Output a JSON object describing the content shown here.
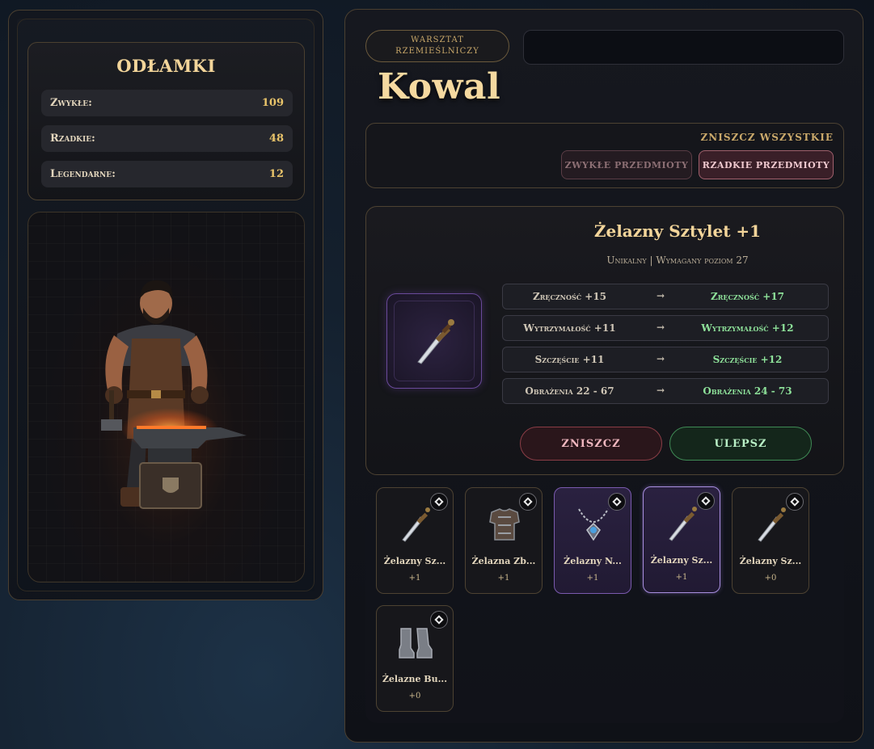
{
  "shards": {
    "title": "ODŁAMKI",
    "rows": [
      {
        "label": "Zwykłe:",
        "value": "109"
      },
      {
        "label": "Rzadkie:",
        "value": "48"
      },
      {
        "label": "Legendarne:",
        "value": "12"
      }
    ]
  },
  "header": {
    "badge_line1": "WARSZTAT",
    "badge_line2": "RZEMIEŚLNICZY",
    "title": "Kowal"
  },
  "destroy_all": {
    "label": "ZNISZCZ WSZYSTKIE",
    "common_button": "ZWYKŁE PRZEDMIOTY",
    "rare_button": "RZADKIE PRZEDMIOTY"
  },
  "selected_item": {
    "name": "Żelazny Sztylet +1",
    "meta": "Unikalny | Wymagany poziom 27",
    "icon": "dagger-icon",
    "stats": [
      {
        "old": "Zręczność +15",
        "arrow": "→",
        "new": "Zręczność +17"
      },
      {
        "old": "Wytrzymałość +11",
        "arrow": "→",
        "new": "Wytrzymałość +12"
      },
      {
        "old": "Szczęście +11",
        "arrow": "→",
        "new": "Szczęście +12"
      },
      {
        "old": "Obrażenia 22 - 67",
        "arrow": "→",
        "new": "Obrażenia 24 - 73"
      }
    ],
    "destroy_button": "ZNISZCZ",
    "upgrade_button": "ULEPSZ"
  },
  "inventory": [
    {
      "name": "Żelazny Sz...",
      "level": "+1",
      "icon": "dagger-icon",
      "rarity": "common",
      "selected": false
    },
    {
      "name": "Żelazna Zb...",
      "level": "+1",
      "icon": "armor-icon",
      "rarity": "common",
      "selected": false
    },
    {
      "name": "Żelazny N...",
      "level": "+1",
      "icon": "necklace-icon",
      "rarity": "epic",
      "selected": false
    },
    {
      "name": "Żelazny Sz...",
      "level": "+1",
      "icon": "dagger-icon",
      "rarity": "epic",
      "selected": true
    },
    {
      "name": "Żelazny Sz...",
      "level": "+0",
      "icon": "dagger-icon",
      "rarity": "common",
      "selected": false
    },
    {
      "name": "Żelazne Bu...",
      "level": "+0",
      "icon": "boots-icon",
      "rarity": "common",
      "selected": false
    }
  ],
  "colors": {
    "gold": "#f3d59a",
    "green_stat": "#8ee29a",
    "epic_border": "#7a5aae"
  }
}
